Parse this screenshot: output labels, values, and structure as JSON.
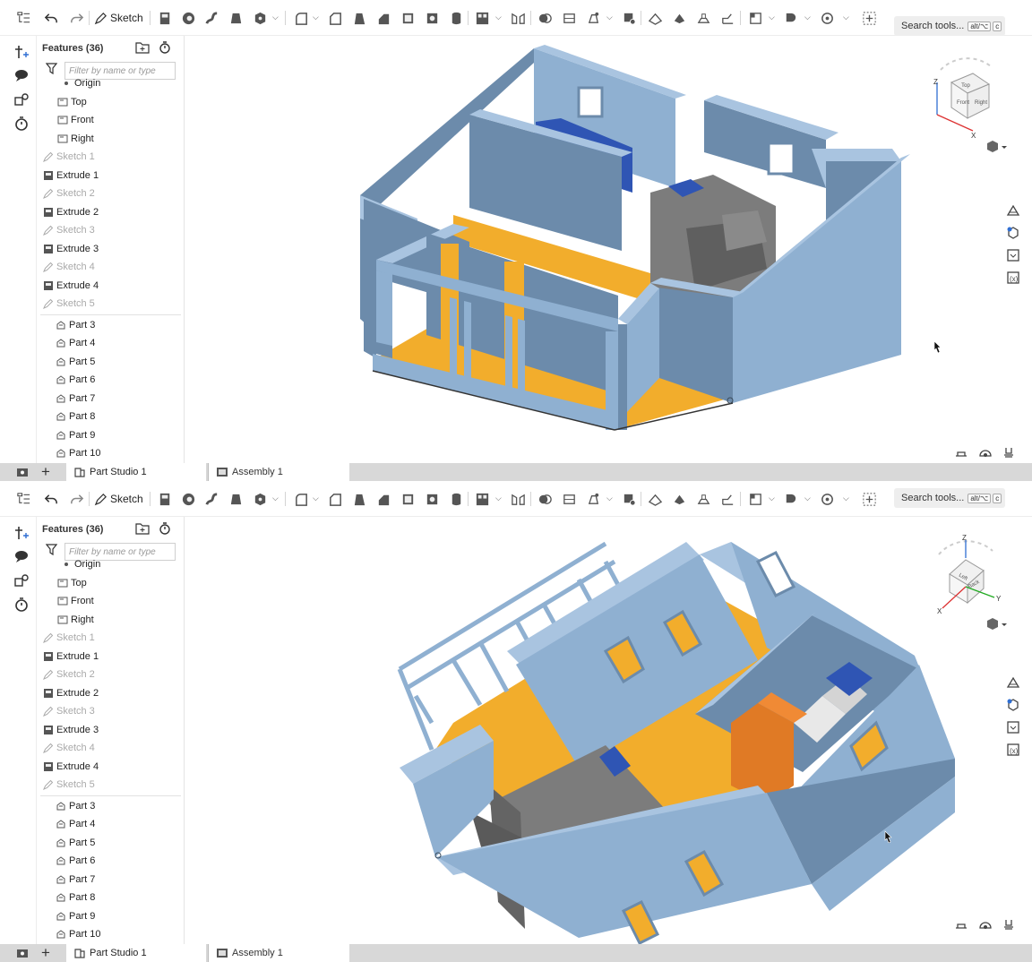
{
  "toolbar": {
    "sketch_label": "Sketch",
    "search_placeholder": "Search tools...",
    "search_kbd": "alt/⌥",
    "search_key": "c"
  },
  "feature_panel": {
    "title": "Features (36)",
    "filter_placeholder": "Filter by name or type",
    "origin_label": "Origin",
    "planes": [
      "Top",
      "Front",
      "Right"
    ],
    "features": [
      {
        "label": "Sketch 1",
        "type": "sketch"
      },
      {
        "label": "Extrude 1",
        "type": "extrude"
      },
      {
        "label": "Sketch 2",
        "type": "sketch"
      },
      {
        "label": "Extrude 2",
        "type": "extrude"
      },
      {
        "label": "Sketch 3",
        "type": "sketch"
      },
      {
        "label": "Extrude 3",
        "type": "extrude"
      },
      {
        "label": "Sketch 4",
        "type": "sketch"
      },
      {
        "label": "Extrude 4",
        "type": "extrude"
      },
      {
        "label": "Sketch 5",
        "type": "sketch"
      }
    ],
    "parts": [
      "Part 3",
      "Part 4",
      "Part 5",
      "Part 6",
      "Part 7",
      "Part 8",
      "Part 9",
      "Part 10"
    ]
  },
  "tabs": {
    "part_studio": "Part Studio 1",
    "assembly": "Assembly 1"
  },
  "viewcube": {
    "view1": {
      "top": "Top",
      "front": "Front",
      "right": "Right",
      "axes": [
        "Z",
        "X"
      ]
    },
    "view2": {
      "face_a": "Left",
      "face_b": "Back",
      "axes": [
        "Z",
        "X",
        "Y"
      ]
    }
  },
  "colors": {
    "wall": "#8fb0d1",
    "wall_dark": "#6c8bab",
    "wall_top": "#a9c4e0",
    "floor": "#f2ad2c",
    "interior_gray": "#7c7c7c",
    "furniture_blue": "#2f55b4",
    "wardrobe_orange": "#e07a25",
    "accent": "#2f6ed3"
  }
}
